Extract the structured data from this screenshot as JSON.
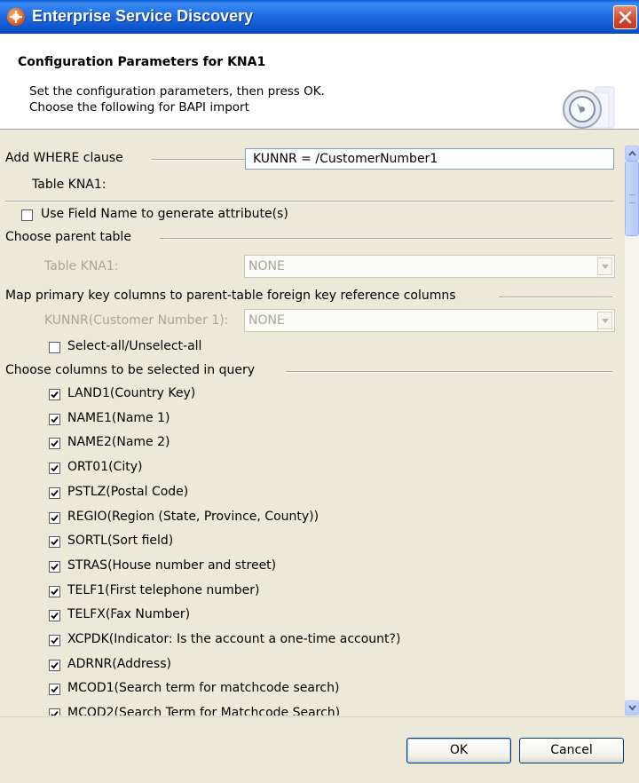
{
  "window": {
    "title": "Enterprise Service Discovery"
  },
  "header": {
    "title": "Configuration Parameters for KNA1",
    "desc_line1": "Set the configuration parameters, then press OK.",
    "desc_line2": "Choose the following for BAPI import"
  },
  "where_clause": {
    "group_label": "Add WHERE clause",
    "table_label": "Table KNA1:",
    "value": "KUNNR = /CustomerNumber1"
  },
  "use_field_name": {
    "label": "Use Field Name to generate attribute(s)",
    "checked": false
  },
  "parent_table": {
    "group_label": "Choose parent table",
    "table_label": "Table KNA1:",
    "value": "NONE"
  },
  "map_keys": {
    "group_label": "Map primary key columns to parent-table foreign key reference columns",
    "column_label": "KUNNR(Customer Number 1):",
    "value": "NONE",
    "select_all_label": "Select-all/Unselect-all",
    "select_all_checked": false
  },
  "columns": {
    "group_label": "Choose columns to be selected in query",
    "items": [
      {
        "label": "LAND1(Country Key)",
        "checked": true
      },
      {
        "label": "NAME1(Name 1)",
        "checked": true
      },
      {
        "label": "NAME2(Name 2)",
        "checked": true
      },
      {
        "label": "ORT01(City)",
        "checked": true
      },
      {
        "label": "PSTLZ(Postal Code)",
        "checked": true
      },
      {
        "label": "REGIO(Region (State, Province, County))",
        "checked": true
      },
      {
        "label": "SORTL(Sort field)",
        "checked": true
      },
      {
        "label": "STRAS(House number and street)",
        "checked": true
      },
      {
        "label": "TELF1(First telephone number)",
        "checked": true
      },
      {
        "label": "TELFX(Fax Number)",
        "checked": true
      },
      {
        "label": "XCPDK(Indicator: Is the account a one-time account?)",
        "checked": true
      },
      {
        "label": "ADRNR(Address)",
        "checked": true
      },
      {
        "label": "MCOD1(Search term for matchcode search)",
        "checked": true
      },
      {
        "label": "MCOD2(Search Term for Matchcode Search)",
        "checked": true
      }
    ]
  },
  "buttons": {
    "ok": "OK",
    "cancel": "Cancel"
  },
  "colors": {
    "title_bar": "#1f6de3",
    "dialog_bg": "#ece9d8",
    "close_button": "#d2472b"
  }
}
